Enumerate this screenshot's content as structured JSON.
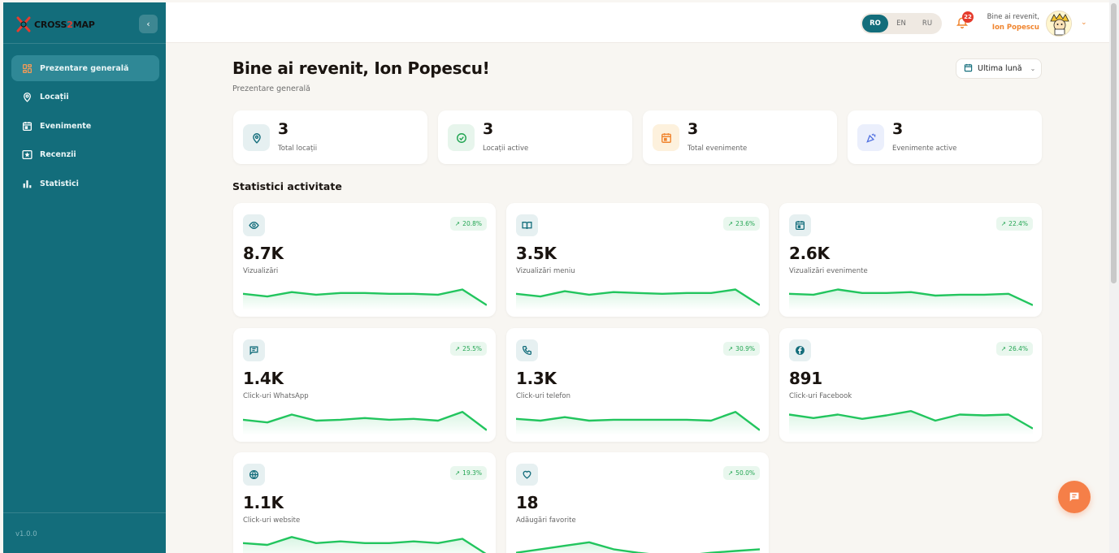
{
  "brand": {
    "prefix": "CROSS",
    "two": "2",
    "suffix": "MAP"
  },
  "sidebar": {
    "collapse": "‹",
    "items": [
      {
        "label": "Prezentare generală",
        "icon": "dashboard-icon",
        "active": true
      },
      {
        "label": "Locații",
        "icon": "map-pin-icon",
        "active": false
      },
      {
        "label": "Evenimente",
        "icon": "calendar-icon",
        "active": false
      },
      {
        "label": "Recenzii",
        "icon": "star-box-icon",
        "active": false
      },
      {
        "label": "Statistici",
        "icon": "bar-chart-icon",
        "active": false
      }
    ],
    "version": "v1.0.0"
  },
  "topbar": {
    "languages": [
      "RO",
      "EN",
      "RU"
    ],
    "selected_language": "RO",
    "notifications_count": "22",
    "welcome_line": "Bine ai revenit,",
    "user_name": "Ion Popescu"
  },
  "main": {
    "title": "Bine ai revenit, Ion Popescu!",
    "subtitle": "Prezentare generală",
    "period_label": "Ultima lună",
    "summary": [
      {
        "value": "3",
        "label": "Total locații",
        "icon": "map-pin-icon",
        "color": "#136d7b",
        "bg": "#e6f0f1"
      },
      {
        "value": "3",
        "label": "Locații active",
        "icon": "check-circle-icon",
        "color": "#22a552",
        "bg": "#e7f5ec"
      },
      {
        "value": "3",
        "label": "Total evenimente",
        "icon": "calendar-icon",
        "color": "#f0852f",
        "bg": "#fdf1dd"
      },
      {
        "value": "3",
        "label": "Evenimente active",
        "icon": "party-popper-icon",
        "color": "#4f6fe0",
        "bg": "#ebeffc"
      }
    ],
    "section_title": "Statistici activitate",
    "stats": [
      {
        "value": "8.7K",
        "label": "Vizualizări",
        "trend": "20.8%",
        "icon": "eye-icon",
        "spark": [
          5,
          2,
          7,
          4,
          6,
          6,
          5,
          5,
          4,
          10,
          -8
        ]
      },
      {
        "value": "3.5K",
        "label": "Vizualizări meniu",
        "trend": "23.6%",
        "icon": "book-open-icon",
        "spark": [
          5,
          2,
          8,
          4,
          7,
          6,
          5,
          6,
          6,
          10,
          -8
        ]
      },
      {
        "value": "2.6K",
        "label": "Vizualizări evenimente",
        "trend": "22.4%",
        "icon": "calendar-icon",
        "spark": [
          5,
          4,
          10,
          6,
          6,
          7,
          3,
          4,
          4,
          5,
          -8
        ]
      },
      {
        "value": "1.4K",
        "label": "Click-uri WhatsApp",
        "trend": "25.5%",
        "icon": "message-square-icon",
        "spark": [
          4,
          1,
          10,
          3,
          4,
          6,
          4,
          5,
          3,
          13,
          -8
        ]
      },
      {
        "value": "1.3K",
        "label": "Click-uri telefon",
        "trend": "30.9%",
        "icon": "phone-icon",
        "spark": [
          5,
          3,
          7,
          3,
          4,
          4,
          4,
          4,
          3,
          13,
          -8
        ]
      },
      {
        "value": "891",
        "label": "Click-uri Facebook",
        "trend": "26.4%",
        "icon": "facebook-icon",
        "spark": [
          10,
          6,
          10,
          5,
          9,
          14,
          3,
          10,
          9,
          10,
          -6
        ]
      },
      {
        "value": "1.1K",
        "label": "Click-uri website",
        "trend": "19.3%",
        "icon": "globe-icon",
        "spark": [
          5,
          3,
          12,
          5,
          7,
          5,
          5,
          7,
          5,
          10,
          -8
        ]
      },
      {
        "value": "18",
        "label": "Adăugări favorite",
        "trend": "50.0%",
        "icon": "heart-icon",
        "spark": [
          -6,
          -2,
          2,
          6,
          -2,
          -6,
          -9,
          -9,
          -6,
          -4,
          -2
        ]
      }
    ]
  }
}
